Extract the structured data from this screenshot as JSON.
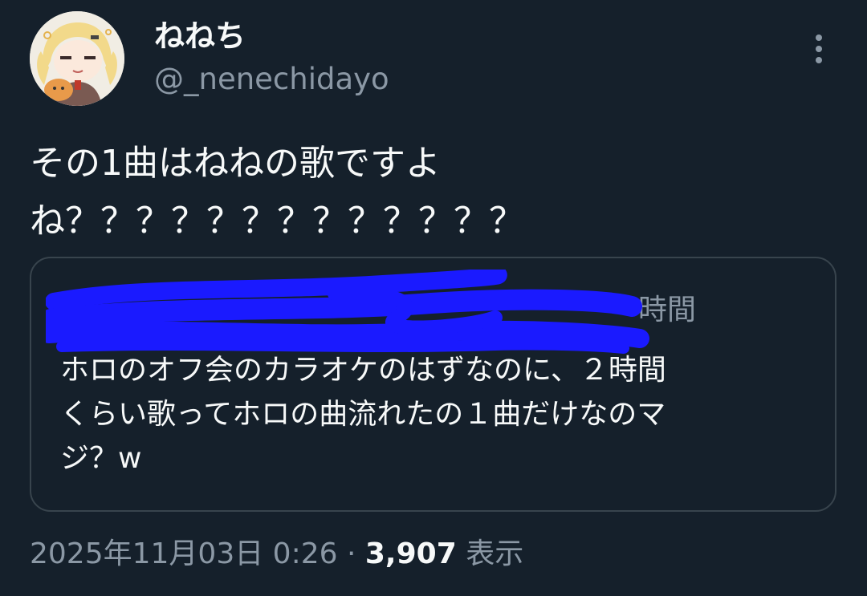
{
  "author": {
    "display_name": "ねねち",
    "handle": "@_nenechidayo"
  },
  "tweet": {
    "text": "その1曲はねねの歌ですよ\nね？？？？？？？？？？？？？"
  },
  "quote": {
    "time_fragment": "時間",
    "text": "ホロのオフ会のカラオケのはずなのに、２時間\nくらい歌ってホロの曲流れたの１曲だけなのマ\nジ？w"
  },
  "meta": {
    "datetime": "2025年11月03日 0:26",
    "separator": " · ",
    "views_count": "3,907",
    "views_label": " 表示"
  },
  "icons": {
    "more": "more-vertical-icon",
    "avatar": "avatar-image"
  },
  "colors": {
    "background": "#15202b",
    "primary_text": "#f7f9f9",
    "secondary_text": "#8b98a5",
    "border": "#38444d",
    "redaction": "#1a1aff"
  }
}
